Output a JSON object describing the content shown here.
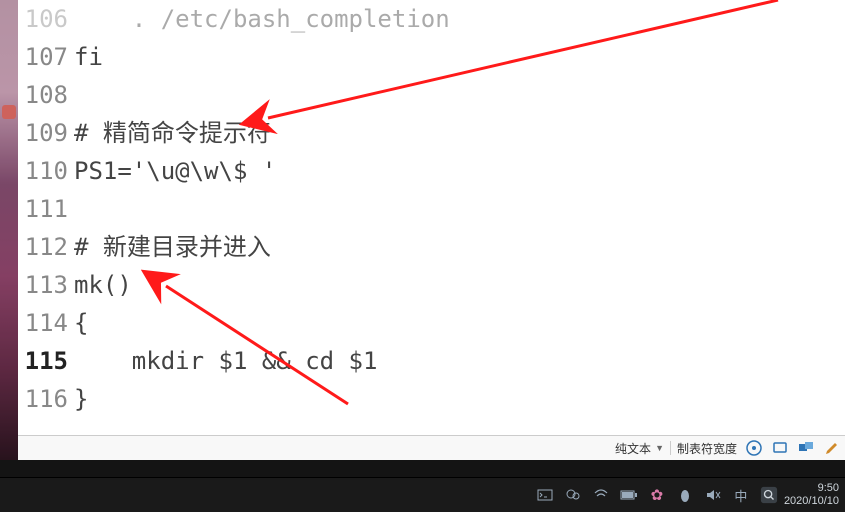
{
  "editor": {
    "lines": [
      {
        "num": "106",
        "text": "    . /etc/bash_completion",
        "top": true
      },
      {
        "num": "107",
        "text": "fi"
      },
      {
        "num": "108",
        "text": ""
      },
      {
        "num": "109",
        "text": "# 精简命令提示符"
      },
      {
        "num": "110",
        "text": "PS1='\\u@\\w\\$ '"
      },
      {
        "num": "111",
        "text": ""
      },
      {
        "num": "112",
        "text": "# 新建目录并进入"
      },
      {
        "num": "113",
        "text": "mk()"
      },
      {
        "num": "114",
        "text": "{"
      },
      {
        "num": "115",
        "text": "    mkdir $1 && cd $1",
        "current": true
      },
      {
        "num": "116",
        "text": "}"
      }
    ],
    "statusbar": {
      "syntax": "纯文本",
      "tabwidth_label": "制表符宽度"
    }
  },
  "taskbar": {
    "time": "9:50",
    "date": "2020/10/10",
    "ime": "中"
  }
}
